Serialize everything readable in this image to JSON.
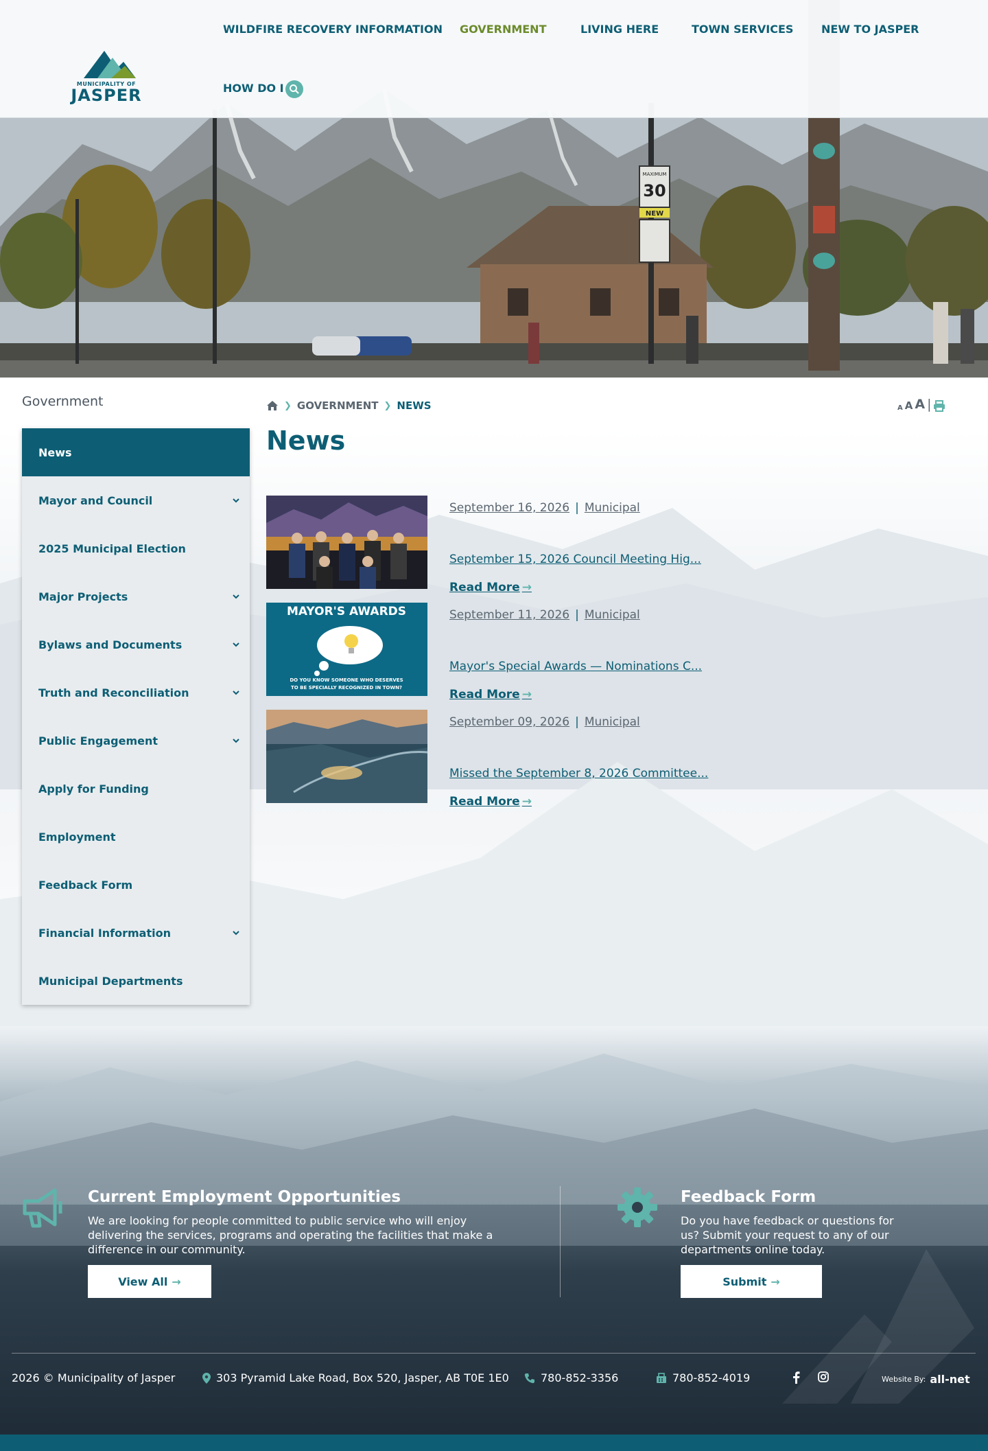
{
  "header": {
    "logo_top": "MUNICIPALITY OF",
    "logo_name": "JASPER",
    "nav": [
      {
        "label": "WILDFIRE RECOVERY INFORMATION"
      },
      {
        "label": "GOVERNMENT",
        "active": true
      },
      {
        "label": "LIVING HERE"
      },
      {
        "label": "TOWN SERVICES"
      },
      {
        "label": "NEW TO JASPER"
      },
      {
        "label": "HOW DO I"
      }
    ]
  },
  "hero": {
    "sign_max": "MAXIMUM",
    "sign_speed": "30",
    "sign_new": "NEW"
  },
  "sidebar": {
    "title": "Government",
    "items": [
      {
        "label": "News",
        "active": true,
        "expandable": false
      },
      {
        "label": "Mayor and Council",
        "expandable": true
      },
      {
        "label": "2025 Municipal Election",
        "expandable": false
      },
      {
        "label": "Major Projects",
        "expandable": true
      },
      {
        "label": "Bylaws and Documents",
        "expandable": true
      },
      {
        "label": "Truth and Reconciliation",
        "expandable": true
      },
      {
        "label": "Public Engagement",
        "expandable": true
      },
      {
        "label": "Apply for Funding",
        "expandable": false
      },
      {
        "label": "Employment",
        "expandable": false
      },
      {
        "label": "Feedback Form",
        "expandable": false
      },
      {
        "label": "Financial Information",
        "expandable": true
      },
      {
        "label": "Municipal Departments",
        "expandable": false
      }
    ]
  },
  "breadcrumb": {
    "items": [
      "GOVERNMENT",
      "NEWS"
    ]
  },
  "font_tools": {
    "small": "A",
    "medium": "A",
    "large": "A",
    "divider": "|"
  },
  "page": {
    "title": "News"
  },
  "news": [
    {
      "date": "September 16, 2026",
      "category": "Municipal",
      "title": "September 15, 2026 Council Meeting Hig...",
      "read_more": "Read More"
    },
    {
      "date": "September 11, 2026",
      "category": "Municipal",
      "title": "Mayor's Special Awards — Nominations C...",
      "read_more": "Read More",
      "thumb_heading": "MAYOR'S AWARDS",
      "thumb_caption_1": "DO YOU KNOW SOMEONE WHO DESERVES",
      "thumb_caption_2": "TO BE SPECIALLY RECOGNIZED IN TOWN?"
    },
    {
      "date": "September 09, 2026",
      "category": "Municipal",
      "title": "Missed the September 8, 2026 Committee...",
      "read_more": "Read More"
    }
  ],
  "footer": {
    "employment": {
      "title": "Current Employment Opportunities",
      "text": "We are looking for people committed to public service who will enjoy delivering the services, programs and operating the facilities that make a difference in our community.",
      "button": "View All"
    },
    "feedback": {
      "title": "Feedback Form",
      "text": "Do you have feedback or questions for us? Submit your request to any of our departments online today.",
      "button": "Submit"
    },
    "copyright": "2026 © Municipality of Jasper",
    "address": "303 Pyramid Lake Road, Box 520, Jasper, AB T0E 1E0",
    "phone": "780-852-3356",
    "fax": "780-852-4019",
    "website_by": "Website By:",
    "builder": "all-net"
  },
  "colors": {
    "primary": "#0d5e74",
    "accent": "#5fb4ab",
    "active_nav": "#6b8b2a"
  }
}
